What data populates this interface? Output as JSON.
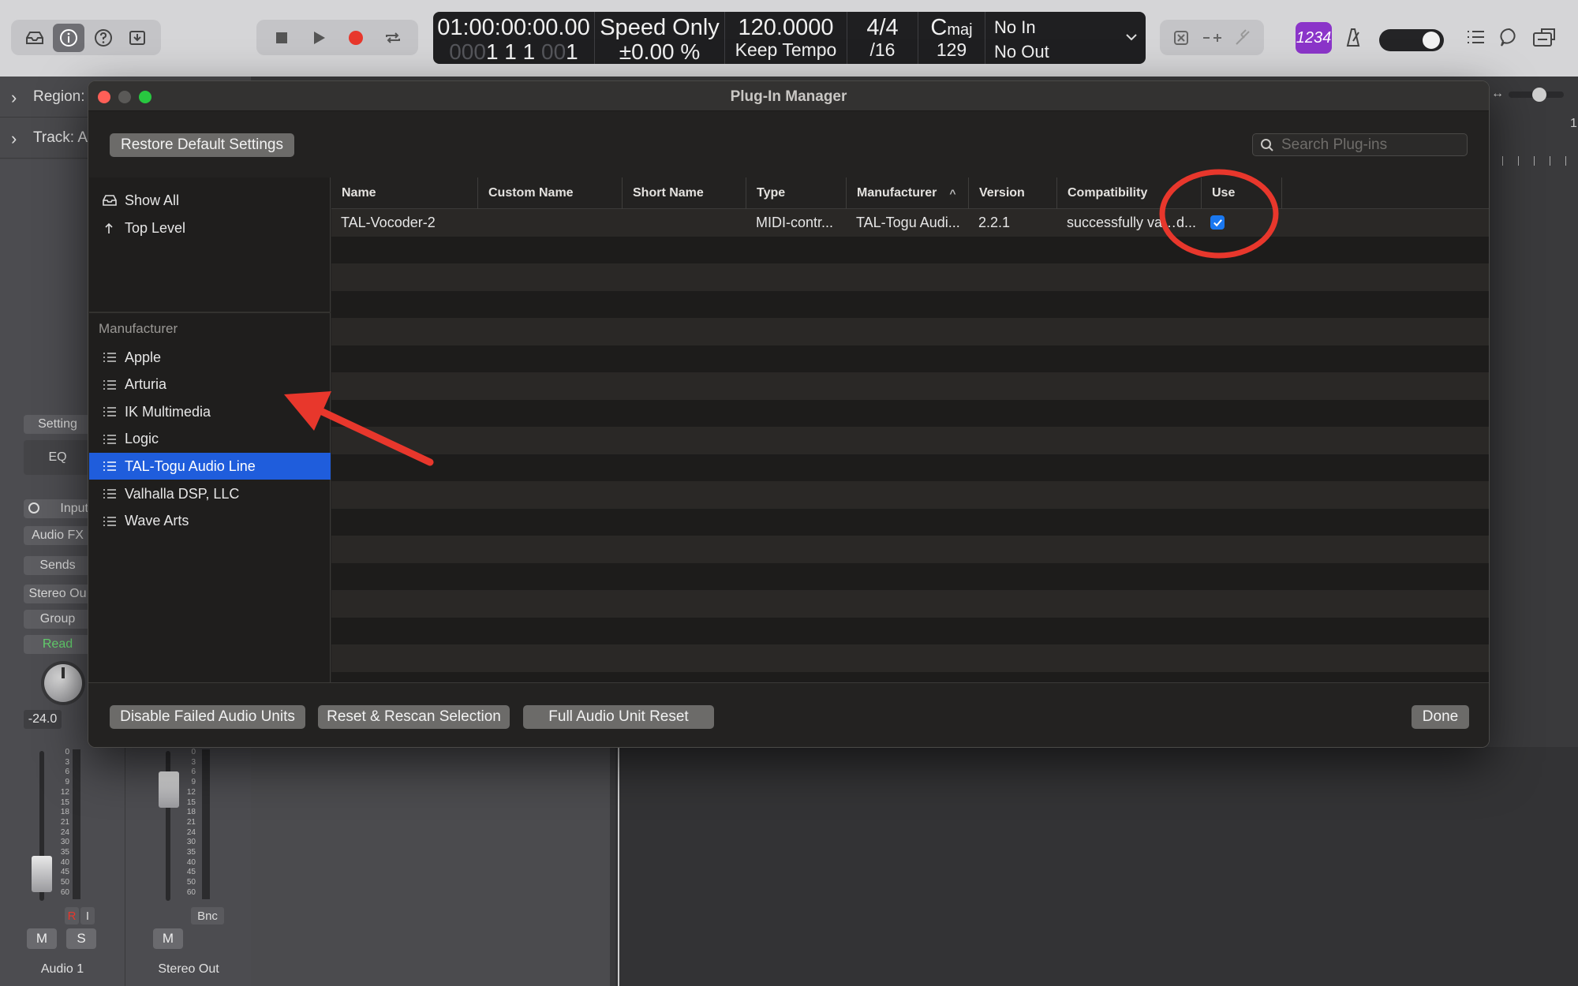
{
  "transport": {
    "position_time": "01:00:00:00.00",
    "position_bars_dim": "000",
    "position_bars": "1  1  1 ",
    "position_bars_dim2": "00",
    "position_bars_last": "1",
    "sync_mode": "Speed Only",
    "sync_offset": "±0.00 %",
    "tempo": "120.0000",
    "tempo_mode": "Keep Tempo",
    "time_signature": "4/4",
    "division": "/16",
    "key_root": "C",
    "key_mode": "maj",
    "key_number": "129",
    "midi_in": "No In",
    "midi_out": "No Out",
    "count_in_label": "1234"
  },
  "inspector": {
    "region_label": "Region:",
    "track_label": "Track:",
    "track_truncated": "A"
  },
  "channel_strip": {
    "setting_label": "Setting",
    "eq_label": "EQ",
    "input_label": "Input",
    "audio_fx_label": "Audio FX",
    "sends_label": "Sends",
    "output_label": "Stereo Ou",
    "group_label": "Group",
    "automation_label": "Read",
    "volume_readout": "-24.0",
    "scale": [
      "0",
      "3",
      "6",
      "9",
      "12",
      "15",
      "18",
      "21",
      "24",
      "30",
      "35",
      "40",
      "45",
      "50",
      "60"
    ],
    "record_label": "R",
    "input_monitor_label": "I",
    "bounce_label": "Bnc",
    "mute_label": "M",
    "solo_label": "S",
    "strip1_name": "Audio 1",
    "strip2_name": "Stereo Out"
  },
  "ruler": {
    "bar_number": "1!"
  },
  "dialog": {
    "title": "Plug-In Manager",
    "restore_button": "Restore Default Settings",
    "search_placeholder": "Search Plug-ins",
    "sidebar": {
      "show_all": "Show All",
      "top_level": "Top Level",
      "heading": "Manufacturer",
      "items": [
        "Apple",
        "Arturia",
        "IK Multimedia",
        "Logic",
        "TAL-Togu Audio Line",
        "Valhalla DSP, LLC",
        "Wave Arts"
      ],
      "selected": "TAL-Togu Audio Line"
    },
    "columns": {
      "name": "Name",
      "custom_name": "Custom Name",
      "short_name": "Short Name",
      "type": "Type",
      "manufacturer": "Manufacturer",
      "version": "Version",
      "compatibility": "Compatibility",
      "use": "Use"
    },
    "rows": [
      {
        "name": "TAL-Vocoder-2",
        "custom_name": "",
        "short_name": "",
        "type": "MIDI-contr...",
        "manufacturer": "TAL-Togu Audi...",
        "version": "2.2.1",
        "compatibility": "successfully va…d...",
        "use": true
      }
    ],
    "footer": {
      "disable_failed": "Disable Failed Audio Units",
      "reset_rescan": "Reset & Rescan Selection",
      "full_reset": "Full Audio Unit Reset",
      "done": "Done"
    }
  },
  "colors": {
    "accent_selection": "#1f5ddc",
    "checkbox": "#1a78f0",
    "annotation_red": "#e8372c",
    "record": "#e8372c",
    "count_in_purple": "#8b35c9",
    "automation_green": "#64d16e"
  }
}
